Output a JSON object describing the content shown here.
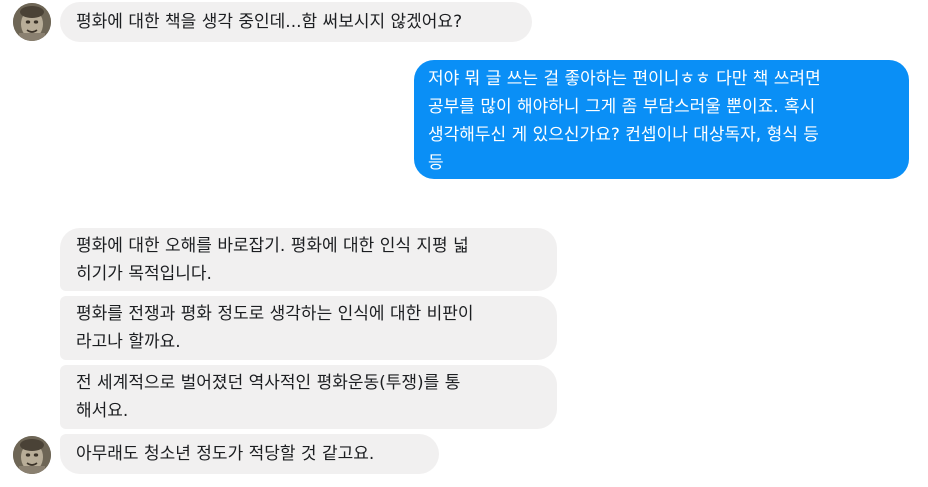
{
  "conversation": {
    "messages": [
      {
        "sender": "them",
        "text": "평화에 대한 책을 생각 중인데...함 써보시지 않겠어요?"
      },
      {
        "sender": "me",
        "text": "저야 뭐 글 쓰는 걸 좋아하는 편이니ㅎㅎ 다만 책 쓰려면\n공부를 많이 해야하니 그게 좀 부담스러울 뿐이죠. 혹시\n생각해두신 게 있으신가요? 컨셉이나 대상독자, 형식 등\n등"
      },
      {
        "sender": "them",
        "text": "평화에 대한 오해를 바로잡기. 평화에 대한 인식 지평 넓\n히기가 목적입니다."
      },
      {
        "sender": "them",
        "text": "평화를 전쟁과 평화 정도로 생각하는 인식에 대한 비판이\n라고나 할까요."
      },
      {
        "sender": "them",
        "text": "전 세계적으로 벌어졌던 역사적인 평화운동(투쟁)를 통\n해서요."
      },
      {
        "sender": "them",
        "text": "아무래도 청소년 정도가 적당할 것 같고요."
      }
    ]
  },
  "colors": {
    "outgoing_bubble": "#0a8ff6",
    "incoming_bubble": "#f1f0f0",
    "incoming_text": "#1c1e21",
    "outgoing_text": "#ffffff"
  },
  "icons": {
    "avatar": "contact-avatar-icon"
  }
}
